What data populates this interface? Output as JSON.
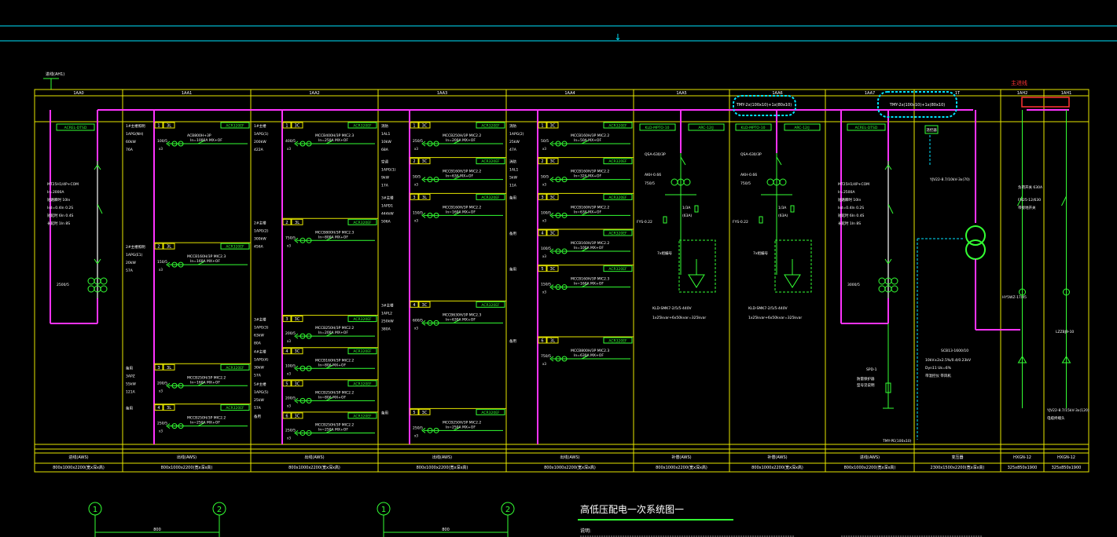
{
  "colors": {
    "background": "#000000",
    "frame": "#e6e600",
    "bus": "#ff33ff",
    "circuit": "#33ff33",
    "text": "#ffffff",
    "highlight": "#00e5ff",
    "redmark": "#ff3333"
  },
  "top_marker": "↓",
  "left_feed_label": "进线(AH1)",
  "red_tag": "主进线",
  "cloud_notes": [
    "TMY-2x(100x10)+1x(80x10)",
    "TMY-2x(100x10)+1x(80x10)"
  ],
  "panels": [
    {
      "id": "1AA0",
      "width": 112,
      "func": "进线(AWS)",
      "size": "800x1000x2200(宽x深x高)",
      "tag": "ACREL-DTSD",
      "left_text": [
        "MT25H1/4P+COM",
        "Ir=2000A",
        "短路瞬时 10In",
        "Isd=0.4In 0.2S",
        "短延时 6In 0.4S",
        "长延时 1In 8S"
      ],
      "ct": "2500/5"
    },
    {
      "id": "1AA1",
      "width": 163,
      "func": "出线(AWS)",
      "size": "800x1000x2200(宽x深x高)",
      "tag": "ACREL-PZ",
      "feeders": [
        {
          "rows": 3,
          "num": "1",
          "phase": "3L",
          "tag": "ACR320EF",
          "left": [
            "1#主楼照明",
            "1APG(NH)",
            "60kW",
            "76A"
          ],
          "ct": "100/5",
          "breaker": [
            "ACB800H+3P",
            "In=1000A  MX+OF"
          ],
          "note": "x3"
        },
        {
          "rows": 3,
          "num": "2",
          "phase": "3L",
          "tag": "ACR320EF",
          "left": [
            "2#主楼照明",
            "1APG(E1)",
            "20kW",
            "57A"
          ],
          "ct": "150/5",
          "breaker": [
            "MCCB160H/3P  MIC2.3",
            "In=160A  MX+OF"
          ],
          "note": "x3"
        },
        {
          "rows": 1,
          "num": "3",
          "phase": "3L",
          "tag": "ACR320EF",
          "left": [
            "备用",
            "3APZ",
            "55kW",
            "121A"
          ],
          "ct": "200/5",
          "breaker": [
            "MCCB250H/3P  MIC2.2",
            "In=160A  MX+OF"
          ],
          "note": "x3"
        },
        {
          "rows": 1,
          "num": "4",
          "phase": "3L",
          "tag": "ACR320EF",
          "left": [
            "备用"
          ],
          "ct": "250/5",
          "breaker": [
            "MCCB250H/3P  MIC2.2",
            "In=250A  MX+OF"
          ],
          "note": "x3"
        }
      ]
    },
    {
      "id": "1AA2",
      "width": 162,
      "func": "出线(AWS)",
      "size": "800x1000x2200(宽x深x高)",
      "tag": "",
      "feeders": [
        {
          "rows": 3,
          "num": "1",
          "phase": "3C",
          "tag": "ACR320EF",
          "left": [
            "1#主楼",
            "1APG(1)",
            "200kW",
            "422A"
          ],
          "ct": "400/5",
          "breaker": [
            "MCCB400H/3P  MIC2.3",
            "In=250A  MX+OF"
          ],
          "note": "x3"
        },
        {
          "rows": 3,
          "num": "2",
          "phase": "3L",
          "tag": "ACR320EF",
          "left": [
            "2#主楼",
            "1APG(2)",
            "300kW",
            "456A"
          ],
          "ct": "750/5",
          "breaker": [
            "MCCB800H/3P  MIC2.3",
            "In=800A  MX+OF"
          ],
          "note": "x3"
        },
        {
          "rows": 1,
          "num": "3",
          "phase": "3C",
          "tag": "ACR320EF",
          "left": [
            "3#主楼",
            "1APG(3)",
            "63kW",
            "80A"
          ],
          "ct": "200/5",
          "breaker": [
            "MCCB250H/3P  MIC2.2",
            "In=200A  MX+OF"
          ],
          "note": "x3"
        },
        {
          "rows": 1,
          "num": "4",
          "phase": "3C",
          "tag": "ACR320EF",
          "left": [
            "4#主楼",
            "1APG(4)",
            "30kW",
            "57A"
          ],
          "ct": "100/5",
          "breaker": [
            "MCCB160H/3P  MIC2.2",
            "In=80A  MX+OF"
          ],
          "note": "x3"
        },
        {
          "rows": 1,
          "num": "5",
          "phase": "3C",
          "tag": "ACR320EF",
          "left": [
            "5#主楼",
            "1APG(5)",
            "25kW",
            "57A"
          ],
          "ct": "200/5",
          "breaker": [
            "MCCB250H/3P  MIC2.2",
            "In=80A  MX+OF"
          ],
          "note": "x3"
        },
        {
          "rows": 1,
          "num": "6",
          "phase": "3C",
          "tag": "ACR320EF",
          "left": [
            "备用"
          ],
          "ct": "250/5",
          "breaker": [
            "MCCB250H/3P  MIC2.2",
            "In=250A  MX+OF"
          ],
          "note": "x3"
        }
      ]
    },
    {
      "id": "1AA3",
      "width": 163,
      "func": "出线(AWS)",
      "size": "800x1000x2200(宽x深x高)",
      "tag": "",
      "feeders": [
        {
          "rows": 1,
          "num": "1",
          "phase": "3C",
          "tag": "ACR320EF",
          "left": [
            "消防",
            "1AL1",
            "10kW",
            "68A"
          ],
          "ct": "250/5",
          "breaker": [
            "MCCB250H/3P  MIC2.2",
            "In=200A  MX+OF"
          ],
          "note": "x3"
        },
        {
          "rows": 1,
          "num": "2",
          "phase": "3C",
          "tag": "ACR320EF",
          "left": [
            "空调",
            "1APG(1)",
            "9kW",
            "17A"
          ],
          "ct": "50/5",
          "breaker": [
            "MCCB160H/3P  MIC2.2",
            "In=63A  MX+OF"
          ],
          "note": "x3"
        },
        {
          "rows": 3,
          "num": "3",
          "phase": "3L",
          "tag": "ACR320EF",
          "left": [
            "3#主楼",
            "1APD1",
            "444kW",
            "506A"
          ],
          "ct": "150/5",
          "breaker": [
            "MCCB160H/3P  MIC2.2",
            "In=160A  MX+OF"
          ],
          "note": "x3"
        },
        {
          "rows": 3,
          "num": "4",
          "phase": "3C",
          "tag": "ACR320EF",
          "left": [
            "3#主楼",
            "1APL2",
            "250kW",
            "380A"
          ],
          "ct": "600/5",
          "breaker": [
            "MCCB630H/3P  MIC2.3",
            "In=630A  MX+OF"
          ],
          "note": "x3"
        },
        {
          "rows": 1,
          "num": "5",
          "phase": "3C",
          "tag": "ACR320EF",
          "left": [
            "备用"
          ],
          "ct": "250/5",
          "breaker": [
            "MCCB250H/3P  MIC2.2",
            "In=250A  MX+OF"
          ],
          "note": "x3"
        }
      ]
    },
    {
      "id": "1AA4",
      "width": 162,
      "func": "出线(AWS)",
      "size": "800x1000x2200(宽x深x高)",
      "tag": "",
      "feeders": [
        {
          "rows": 1,
          "num": "1",
          "phase": "3C",
          "tag": "ACR320EF",
          "left": [
            "消防",
            "1APG(2)",
            "25kW",
            "47A"
          ],
          "ct": "50/5",
          "breaker": [
            "MCCB160H/3P  MIC2.2",
            "In=50A  MX+OF"
          ],
          "note": "x3"
        },
        {
          "rows": 1,
          "num": "2",
          "phase": "3C",
          "tag": "ACR320EF",
          "left": [
            "消防",
            "1AL1",
            "5kW",
            "11A"
          ],
          "ct": "50/5",
          "breaker": [
            "MCCB160H/3P  MIC2.2",
            "In=32A  MX+OF"
          ],
          "note": "x3"
        },
        {
          "rows": 1,
          "num": "3",
          "phase": "3C",
          "tag": "ACR320EF",
          "left": [
            "备用"
          ],
          "ct": "100/5",
          "breaker": [
            "MCCB160H/3P  MIC2.2",
            "In=63A  MX+OF"
          ],
          "note": "x3"
        },
        {
          "rows": 1,
          "num": "4",
          "phase": "3C",
          "tag": "ACR320EF",
          "left": [
            "备用"
          ],
          "ct": "100/5",
          "breaker": [
            "MCCB160H/3P  MIC2.2",
            "In=100A  MX+OF"
          ],
          "note": "x3"
        },
        {
          "rows": 2,
          "num": "5",
          "phase": "3C",
          "tag": "ACR320EF",
          "left": [
            "备用"
          ],
          "ct": "150/5",
          "breaker": [
            "MCCB160H/3P  MIC2.3",
            "In=160A  MX+OF"
          ],
          "note": "x3"
        },
        {
          "rows": 3,
          "num": "6",
          "phase": "3L",
          "tag": "ACR320EF",
          "left": [
            "备用"
          ],
          "ct": "750/5",
          "breaker": [
            "MCCB800H/3P  MIC2.3",
            "In=630A  MX+OF"
          ],
          "note": "x3"
        }
      ]
    },
    {
      "id": "1AA5",
      "width": 122,
      "func": "补偿(AWS)",
      "size": "800x1000x2200(宽x深x高)",
      "tag": "ARC-12/J",
      "cap": {
        "tag": "KLD-MPTO-10",
        "switch": "QSA-630/3P",
        "ct_a": "AKH-0.66",
        "ct": "750/5",
        "fuse": "63A",
        "lightning": "FYS-0.22",
        "group": "7x组编号",
        "model": "KLD-SMK7-2/5/5-440V",
        "spec": "1x25kvar+6x50kvar=325kvar"
      }
    },
    {
      "id": "1AA6",
      "width": 122,
      "func": "补偿(AWS)",
      "size": "800x1000x2200(宽x深x高)",
      "tag": "ARC-12/J",
      "cap": {
        "tag": "KLD-MPTO-10",
        "switch": "QSA-630/3P",
        "ct_a": "AKH-0.66",
        "ct": "750/5",
        "fuse": "63A",
        "lightning": "FYS-0.22",
        "group": "7x组编号",
        "model": "KLD-SMK7-2/5/5-440V",
        "spec": "1x25kvar+6x50kvar=325kvar"
      }
    },
    {
      "id": "1AA7",
      "width": 113,
      "func": "进线(AWS)",
      "size": "800x1000x2200(宽x深x高)",
      "tag": "ACREL-DTSD",
      "left_text": [
        "MT25H1/4P+COM",
        "Ir=2500A",
        "短路瞬时 10In",
        "Isd=0.4In 0.2S",
        "短延时 6In 0.4S",
        "长延时 1In 8S"
      ],
      "ct": "3000/5",
      "spd": "SPD-1",
      "spd_note": [
        "防雷保护器",
        "型号见说明"
      ]
    },
    {
      "id": "1T",
      "width": 110,
      "func": "变压器",
      "size": "2300x1500x2200(宽x深x高)",
      "trans": {
        "label": "SCB13-1600/10",
        "note": [
          "10kV±2x2.5%/0.4/0.23kV",
          "Dyn11 Uk=6%",
          "带温控仪 带风机"
        ],
        "cable": "YJV22-8.7/10kV-3x(70)",
        "pe": "TMY-PE(100x10)",
        "tag": "温控器"
      }
    },
    {
      "id": "1AH2",
      "width": 55,
      "func": "HXGN-12",
      "size": "325x850x1900",
      "hv": true
    },
    {
      "id": "1AH1",
      "width": 57,
      "func": "HXGN-12",
      "size": "325x850x1900",
      "hv": true,
      "cable": "YJV22-8.7/15kV-3x(120)",
      "cable2": "电缆终端头"
    }
  ],
  "hv": {
    "breaker": "负荷开关 630A",
    "fuse": "熔断器",
    "spec": [
      "FN25-12/630",
      "带接地开关"
    ],
    "arrester": "HY5WZ-17/45",
    "ct": "LZZBJ9-10"
  },
  "title": "高低压配电一次系统图一",
  "notes_label": "说明:",
  "axis_labels": [
    "1",
    "2",
    "1",
    "2"
  ],
  "axis_dim": "800"
}
